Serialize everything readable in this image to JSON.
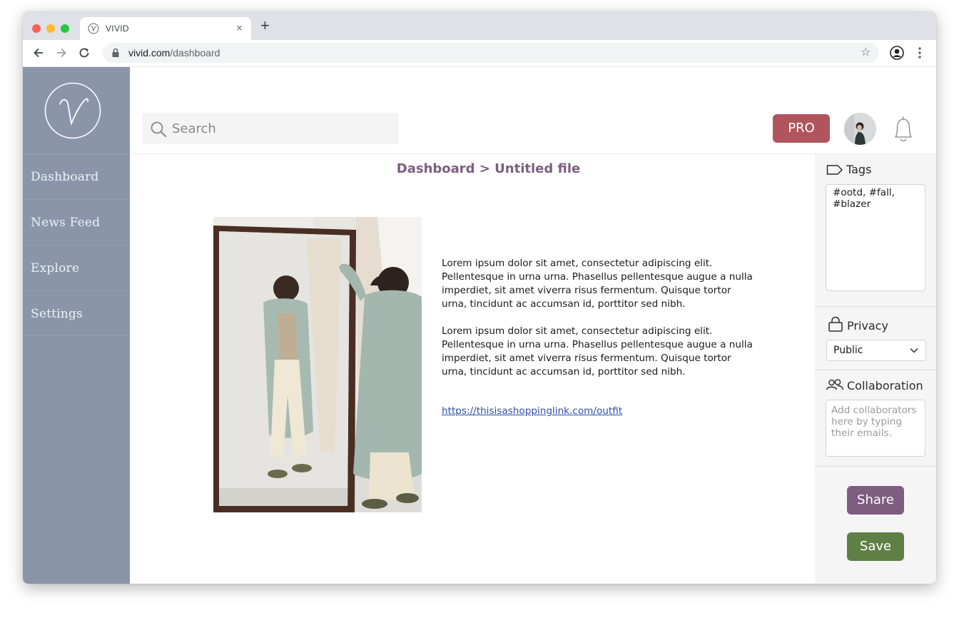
{
  "browser": {
    "tab_title": "VIVID",
    "tab_close": "×",
    "new_tab": "+",
    "url_domain": "vivid.com",
    "url_path": "/dashboard",
    "star": "☆"
  },
  "sidebar": {
    "items": [
      {
        "label": "Dashboard"
      },
      {
        "label": "News Feed"
      },
      {
        "label": "Explore"
      },
      {
        "label": "Settings"
      }
    ]
  },
  "header": {
    "search_placeholder": "Search",
    "pro_label": "PRO"
  },
  "main": {
    "breadcrumb": "Dashboard > Untitled file",
    "paragraphs": [
      "Lorem ipsum dolor sit amet, consectetur adipiscing elit. Pellentesque in urna urna. Phasellus pellentesque augue a nulla imperdiet, sit amet viverra risus fermentum. Quisque tortor urna, tincidunt ac accumsan id, porttitor sed nibh.",
      "Lorem ipsum dolor sit amet, consectetur adipiscing elit. Pellentesque in urna urna. Phasellus pellentesque augue a nulla imperdiet, sit amet viverra risus fermentum. Quisque tortor urna, tincidunt ac accumsan id, porttitor sed nibh."
    ],
    "link": "https://thisisashoppinglink.com/outfit"
  },
  "panel": {
    "tags_title": "Tags",
    "tags_value": "#ootd, #fall, #blazer",
    "privacy_title": "Privacy",
    "privacy_value": "Public",
    "collab_title": "Collaboration",
    "collab_placeholder": "Add collaborators here by typing their emails.",
    "share_label": "Share",
    "save_label": "Save"
  },
  "colors": {
    "sidebar": "#8b95aa",
    "pro": "#b0555d",
    "accent_purple": "#7d5d80",
    "save_green": "#5e8044",
    "link": "#2e4ea5"
  },
  "icons": [
    "vivid-logo-icon",
    "back-icon",
    "forward-icon",
    "reload-icon",
    "lock-icon",
    "star-icon",
    "profile-icon",
    "more-icon",
    "search-icon",
    "bell-icon",
    "tag-icon",
    "padlock-icon",
    "people-icon",
    "chevron-down-icon"
  ]
}
